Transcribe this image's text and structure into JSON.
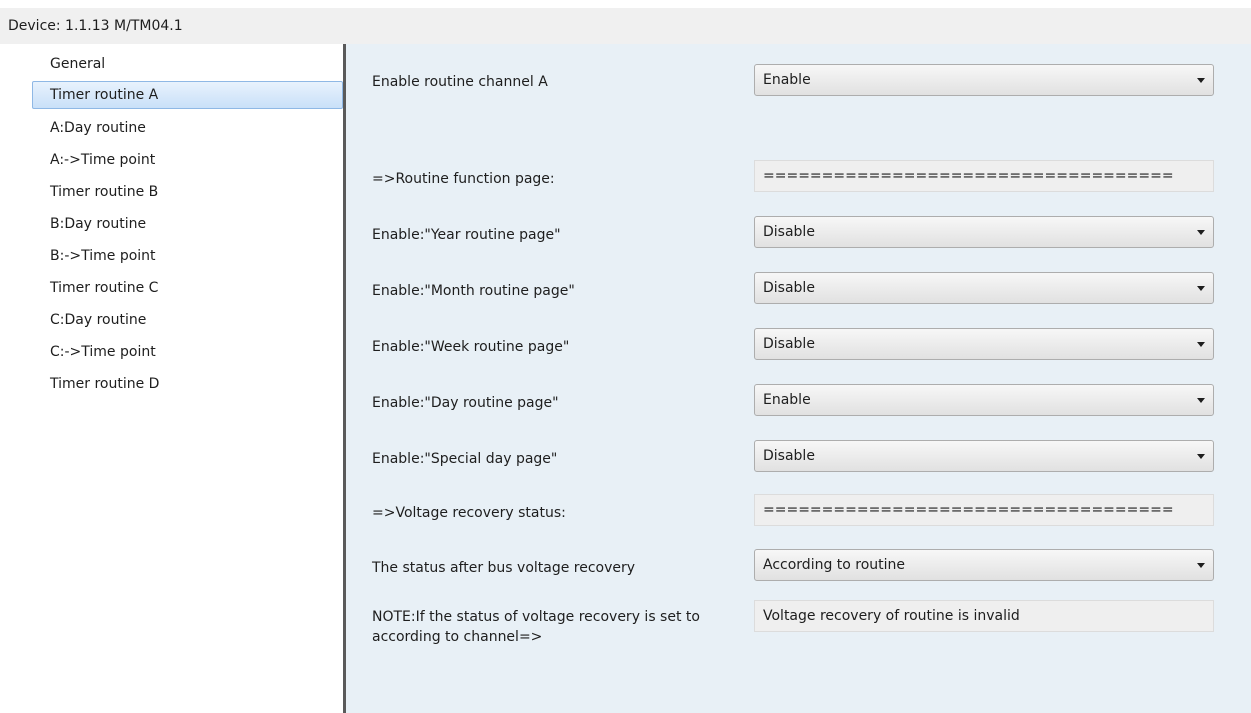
{
  "window": {
    "title": "Device: 1.1.13  M/TM04.1"
  },
  "sidebar": {
    "items": [
      {
        "label": "General"
      },
      {
        "label": "Timer routine A"
      },
      {
        "label": "A:Day routine"
      },
      {
        "label": "A:->Time point"
      },
      {
        "label": "Timer routine B"
      },
      {
        "label": "B:Day routine"
      },
      {
        "label": "B:->Time point"
      },
      {
        "label": "Timer routine C"
      },
      {
        "label": "C:Day routine"
      },
      {
        "label": "C:->Time point"
      },
      {
        "label": "Timer routine D"
      }
    ],
    "selected": "Timer routine A"
  },
  "params": {
    "enable_channel_a": {
      "label": "Enable routine channel A",
      "value": "Enable"
    },
    "routine_function_page": {
      "label": "=>Routine function page:",
      "value": "==================================="
    },
    "year_routine_page": {
      "label": "Enable:\"Year routine page\"",
      "value": "Disable"
    },
    "month_routine_page": {
      "label": "Enable:\"Month routine page\"",
      "value": "Disable"
    },
    "week_routine_page": {
      "label": "Enable:\"Week routine page\"",
      "value": "Disable"
    },
    "day_routine_page": {
      "label": "Enable:\"Day routine page\"",
      "value": "Enable"
    },
    "special_day_page": {
      "label": "Enable:\"Special day page\"",
      "value": "Disable"
    },
    "voltage_recovery_status": {
      "label": "=>Voltage recovery status:",
      "value": "==================================="
    },
    "status_after_recovery": {
      "label": "The status after bus voltage recovery",
      "value": "According to routine"
    },
    "note": {
      "label": "NOTE:If the status of voltage recovery is set to according to channel=>",
      "value": "Voltage recovery of routine is invalid"
    }
  }
}
